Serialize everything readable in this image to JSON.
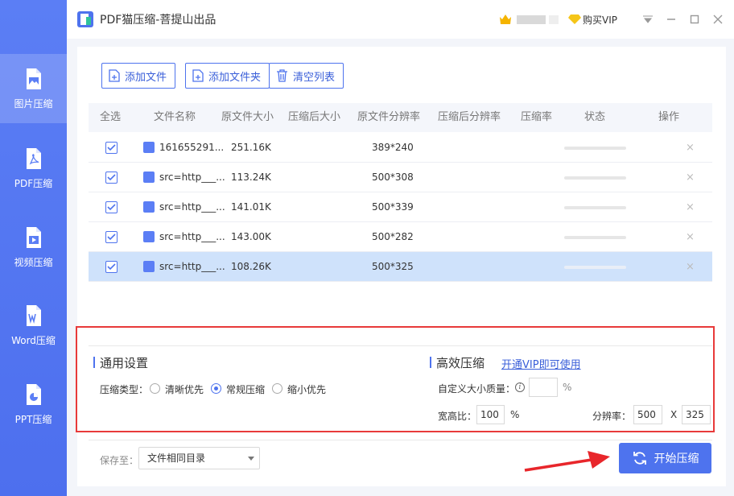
{
  "app": {
    "title": "PDF猫压缩-菩提山出品"
  },
  "titlebar": {
    "vip_label": "购买VIP"
  },
  "sidebar": {
    "items": [
      {
        "label": "图片压缩",
        "active": true
      },
      {
        "label": "PDF压缩",
        "active": false
      },
      {
        "label": "视频压缩",
        "active": false
      },
      {
        "label": "Word压缩",
        "active": false
      },
      {
        "label": "PPT压缩",
        "active": false
      }
    ]
  },
  "toolbar": {
    "add_file": "添加文件",
    "add_folder": "添加文件夹",
    "clear_list": "清空列表"
  },
  "table": {
    "headers": [
      "全选",
      "文件名称",
      "原文件大小",
      "压缩后大小",
      "原文件分辨率",
      "压缩后分辨率",
      "压缩率",
      "状态",
      "操作"
    ],
    "rows": [
      {
        "name": "161655291...",
        "size": "251.16K",
        "resolution": "389*240",
        "checked": true,
        "selected": false
      },
      {
        "name": "src=http___...",
        "size": "113.24K",
        "resolution": "500*308",
        "checked": true,
        "selected": false
      },
      {
        "name": "src=http___...",
        "size": "141.01K",
        "resolution": "500*339",
        "checked": true,
        "selected": false
      },
      {
        "name": "src=http___...",
        "size": "143.00K",
        "resolution": "500*282",
        "checked": true,
        "selected": false
      },
      {
        "name": "src=http___...",
        "size": "108.26K",
        "resolution": "500*325",
        "checked": true,
        "selected": true
      }
    ],
    "delete_glyph": "×"
  },
  "settings": {
    "general_title": "通用设置",
    "compress_type_label": "压缩类型：",
    "options": [
      "清晰优先",
      "常规压缩",
      "缩小优先"
    ],
    "selected_option": "常规压缩",
    "efficient_title": "高效压缩",
    "vip_link": "开通VIP即可使用",
    "custom_size_label": "自定义大小质量：",
    "info_glyph": "i",
    "custom_size_value": "",
    "percent_sign": "%",
    "aspect_label": "宽高比：",
    "aspect_value": "100",
    "resolution_label": "分辨率：",
    "res_width": "500",
    "res_x": "X",
    "res_height": "325"
  },
  "footer": {
    "save_label": "保存至：",
    "save_value": "文件相同目录",
    "start_button": "开始压缩"
  },
  "colors": {
    "accent": "#4e73ee",
    "highlight_border": "#e83a3a",
    "selected_row": "#cfe2fb"
  }
}
